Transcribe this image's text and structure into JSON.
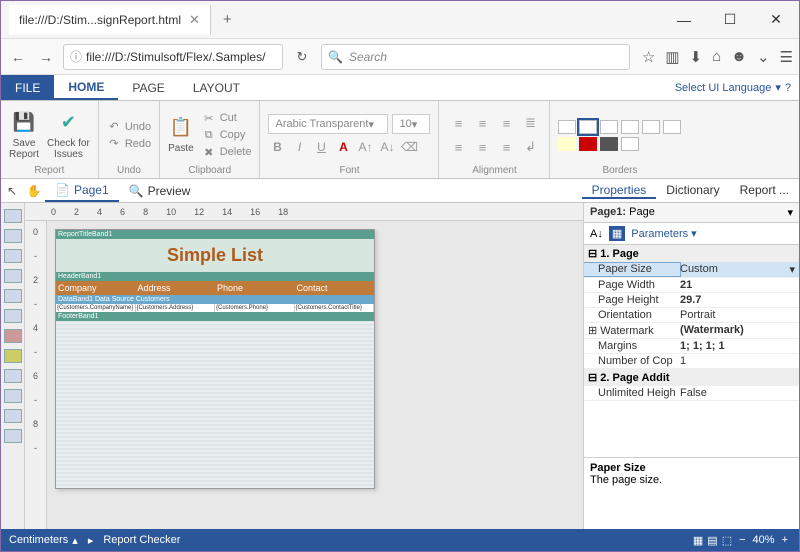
{
  "browser": {
    "tab_title": "file:///D:/Stim...signReport.html",
    "url": "file:///D:/Stimulsoft/Flex/.Samples/",
    "search_placeholder": "Search"
  },
  "app_tabs": {
    "file": "FILE",
    "home": "HOME",
    "page": "PAGE",
    "layout": "LAYOUT",
    "lang": "Select UI Language"
  },
  "ribbon": {
    "report": {
      "save": "Save\nReport",
      "check": "Check for\nIssues",
      "label": "Report"
    },
    "undo_grp": {
      "undo": "Undo",
      "redo": "Redo",
      "label": "Undo"
    },
    "clipboard": {
      "paste": "Paste",
      "cut": "Cut",
      "copy": "Copy",
      "delete": "Delete",
      "label": "Clipboard"
    },
    "font": {
      "name": "Arabic Transparent",
      "size": "10",
      "label": "Font"
    },
    "alignment": {
      "label": "Alignment"
    },
    "borders": {
      "label": "Borders"
    }
  },
  "design": {
    "page1": "Page1",
    "preview": "Preview"
  },
  "ruler_h": [
    "0",
    "2",
    "4",
    "6",
    "8",
    "10",
    "12",
    "14",
    "16",
    "18"
  ],
  "ruler_v": [
    "0",
    "-",
    "2",
    "-",
    "4",
    "-",
    "6",
    "-",
    "8",
    "-"
  ],
  "prop_tabs": {
    "properties": "Properties",
    "dictionary": "Dictionary",
    "report": "Report ..."
  },
  "prop_header": {
    "name": "Page1:",
    "type": "Page"
  },
  "prop_params": "Parameters",
  "prop_sections": {
    "s1": "1. Page",
    "s2": "2. Page Addit"
  },
  "props": {
    "paper_size": {
      "k": "Paper Size",
      "v": "Custom"
    },
    "page_width": {
      "k": "Page Width",
      "v": "21"
    },
    "page_height": {
      "k": "Page Height",
      "v": "29.7"
    },
    "orientation": {
      "k": "Orientation",
      "v": "Portrait"
    },
    "watermark": {
      "k": "Watermark",
      "v": "(Watermark)"
    },
    "margins": {
      "k": "Margins",
      "v": "1; 1; 1; 1"
    },
    "copies": {
      "k": "Number of Cop",
      "v": "1"
    },
    "unlimited": {
      "k": "Unlimited Heigh",
      "v": "False"
    }
  },
  "prop_desc": {
    "title": "Paper Size",
    "text": "The page size."
  },
  "report_preview": {
    "title_band": "ReportTitleBand1",
    "title": "Simple List",
    "header_band": "HeaderBand1",
    "cols": [
      "Company",
      "Address",
      "Phone",
      "Contact"
    ],
    "data_band": "DataBand1 Data Source Customers",
    "cells": [
      "{Customers.CompanyName}",
      "{Customers.Address}",
      "{Customers.Phone}",
      "{Customers.ContactTitle}"
    ],
    "footer_band": "FooterBand1"
  },
  "status": {
    "units": "Centimeters",
    "checker": "Report Checker",
    "zoom": "40%"
  }
}
